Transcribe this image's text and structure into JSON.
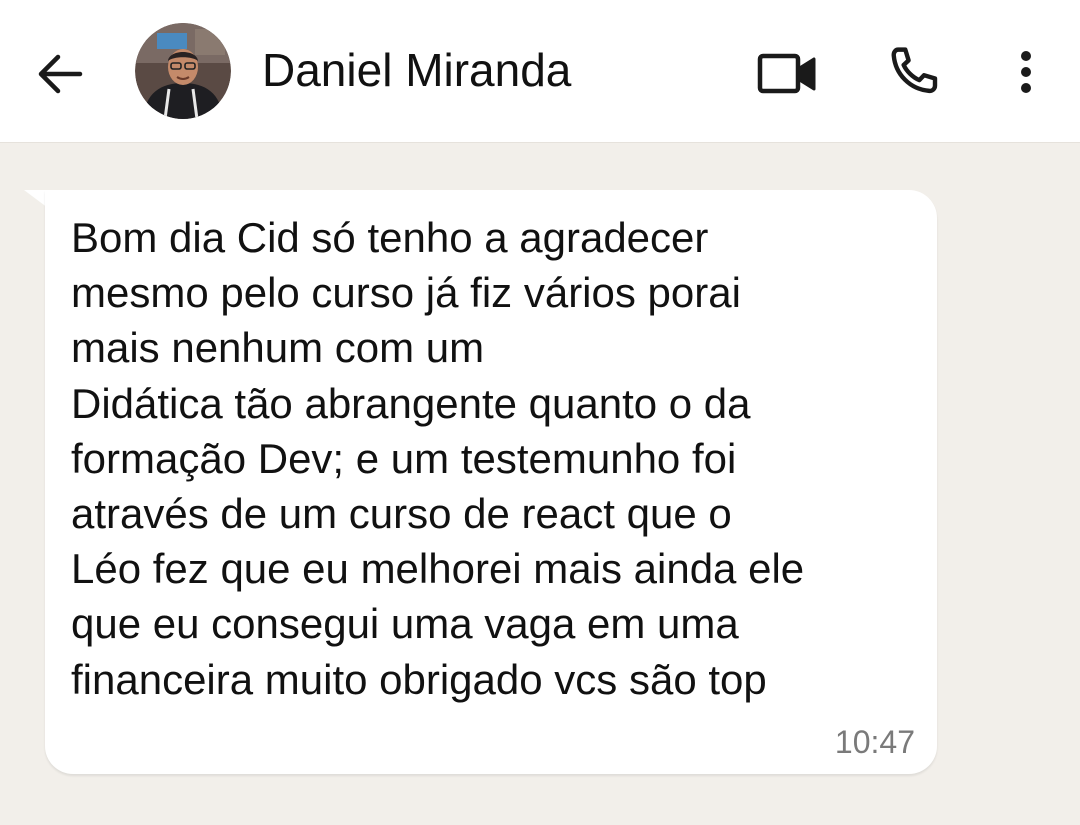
{
  "header": {
    "contact_name": "Daniel Miranda",
    "back_icon": "arrow-left-icon",
    "video_icon": "video-camera-icon",
    "call_icon": "phone-icon",
    "menu_icon": "more-vertical-icon"
  },
  "message": {
    "text": "Bom dia Cid só tenho a agradecer\nmesmo pelo curso já fiz vários porai\nmais nenhum com um\nDidática tão abrangente quanto o da\nformação Dev; e um testemunho foi\natravés de um curso de react que o\nLéo fez que eu melhorei mais ainda ele\nque eu consegui uma vaga em uma\nfinanceira muito obrigado vcs são top",
    "time": "10:47",
    "direction": "incoming"
  },
  "colors": {
    "header_bg": "#ffffff",
    "chat_bg": "#f2efea",
    "bubble_bg": "#ffffff",
    "text": "#111111",
    "timestamp": "#7a7a7a"
  }
}
